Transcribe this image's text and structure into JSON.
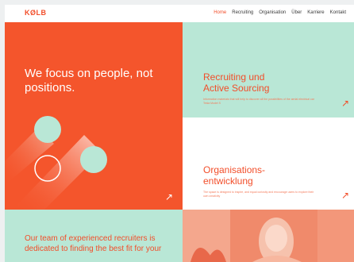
{
  "header": {
    "logo": "KØLB",
    "nav": [
      {
        "label": "Home",
        "active": true
      },
      {
        "label": "Recruiting"
      },
      {
        "label": "Organisation"
      },
      {
        "label": "Über"
      },
      {
        "label": "Karriere"
      },
      {
        "label": "Kontakt"
      }
    ]
  },
  "hero": {
    "headline": "We focus on people, not positions.",
    "arrow": "↗"
  },
  "cards": {
    "recruiting": {
      "title": "Recruiting und\nActive Sourcing",
      "description": "Information materials that will help to discover all the possibilities of the aerial electrical car Tesla Model S",
      "arrow": "↗"
    },
    "organisation": {
      "title": "Organisations-\nentwicklung",
      "description": "The space is designed to inspire, and equal curiosity and encourage users to explore their own creativity",
      "arrow": "↗"
    }
  },
  "bottom": {
    "text": "Our team of experienced recruiters is dedicated to finding the best fit for your"
  },
  "colors": {
    "orange": "#f4552c",
    "mint": "#b9e7d6",
    "accent": "#f24e2a"
  },
  "icons": {
    "arrow": "arrow-up-right-icon"
  }
}
